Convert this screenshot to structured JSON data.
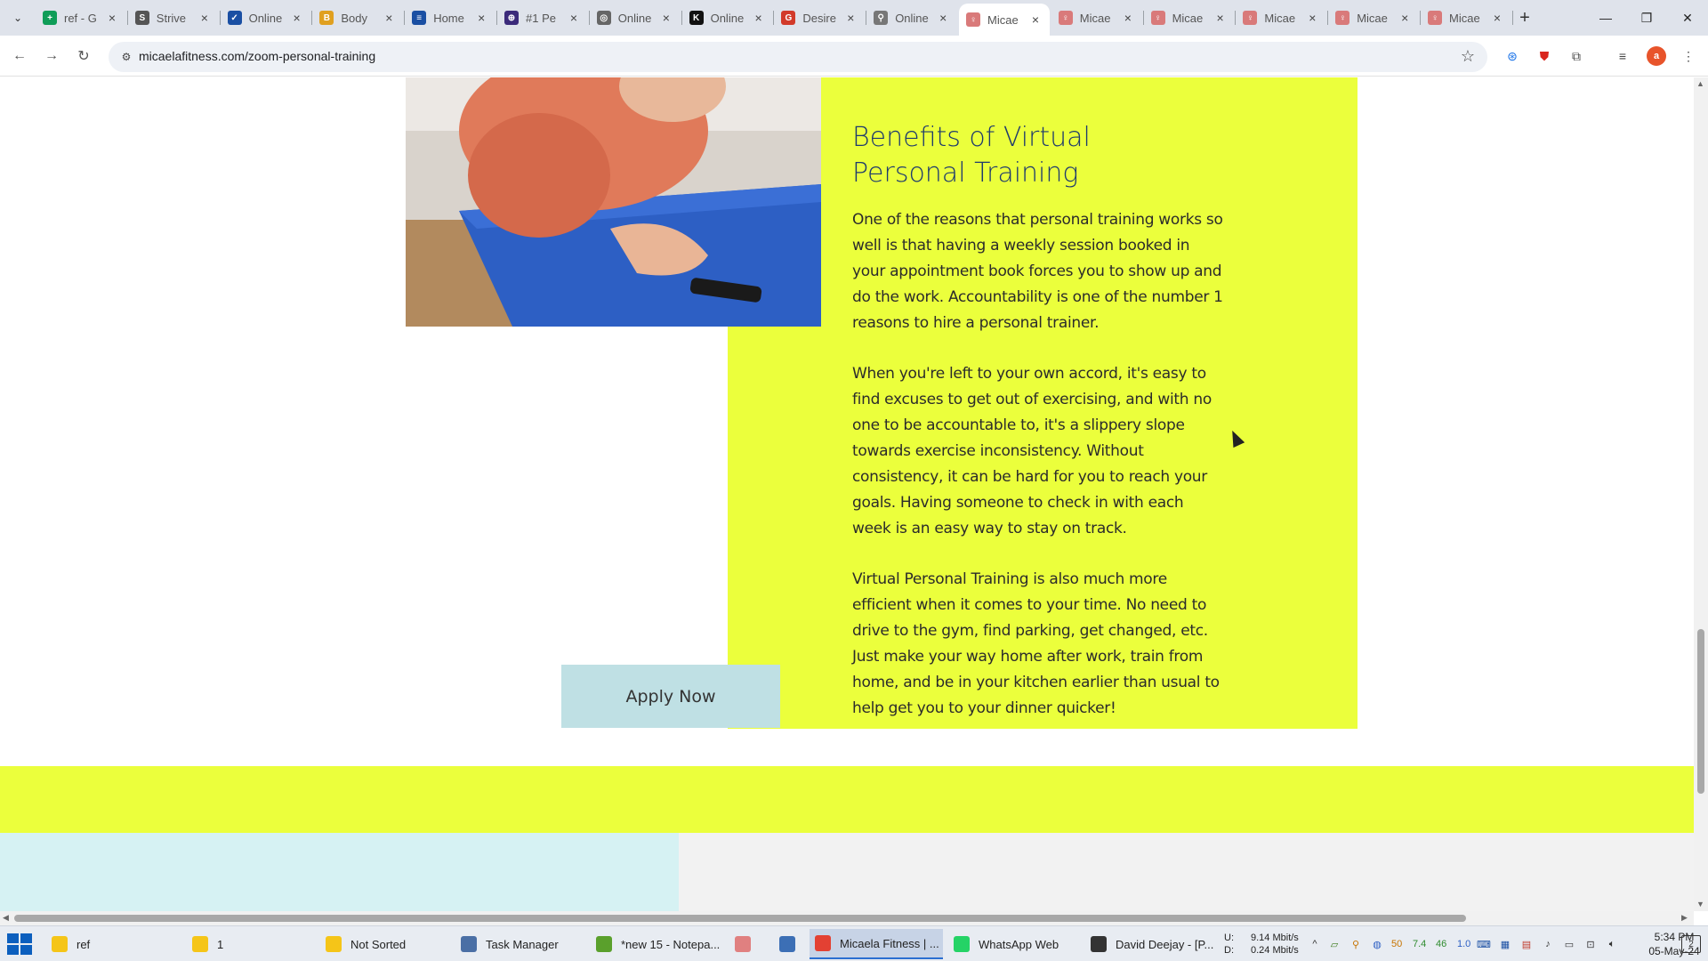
{
  "browser": {
    "tabs": [
      {
        "title": "ref - G",
        "color": "#0f9d58",
        "glyph": "+"
      },
      {
        "title": "Strive",
        "color": "#555555",
        "glyph": "S"
      },
      {
        "title": "Online",
        "color": "#1a4fa3",
        "glyph": "✓"
      },
      {
        "title": "Body",
        "color": "#e0a020",
        "glyph": "B"
      },
      {
        "title": "Home",
        "color": "#1a4fa3",
        "glyph": "≡"
      },
      {
        "title": "#1 Pe",
        "color": "#3b2a7a",
        "glyph": "⊕"
      },
      {
        "title": "Online",
        "color": "#666666",
        "glyph": "◎"
      },
      {
        "title": "Online",
        "color": "#111111",
        "glyph": "K"
      },
      {
        "title": "Desire",
        "color": "#d23a2a",
        "glyph": "G"
      },
      {
        "title": "Online",
        "color": "#777777",
        "glyph": "⚲"
      },
      {
        "title": "Micae",
        "color": "#d97a7a",
        "glyph": "♀",
        "active": true
      },
      {
        "title": "Micae",
        "color": "#d97a7a",
        "glyph": "♀"
      },
      {
        "title": "Micae",
        "color": "#d97a7a",
        "glyph": "♀"
      },
      {
        "title": "Micae",
        "color": "#d97a7a",
        "glyph": "♀"
      },
      {
        "title": "Micae",
        "color": "#d97a7a",
        "glyph": "♀"
      },
      {
        "title": "Micae",
        "color": "#d97a7a",
        "glyph": "♀"
      }
    ],
    "url": "micaelafitness.com/zoom-personal-training",
    "profile_initial": "a"
  },
  "page": {
    "heading": "Benefits of Virtual Personal Training",
    "paragraphs": [
      "One of the reasons that personal training works so well is that having a weekly session booked in your appointment book forces you to show up and do the work. Accountability is one of the number 1 reasons to hire a personal trainer.",
      "When you're left to your own accord, it's easy to find excuses to get out of exercising, and with no one to be accountable to, it's a slippery slope towards exercise inconsistency.  Without consistency, it can be hard for you to reach your goals. Having someone to check in with each week is an easy way to stay on track.",
      "Virtual Personal Training is also much more efficient when it comes to your time. No need to drive to the gym, find parking, get changed, etc. Just make your way home after work, train from home, and be in your kitchen earlier than usual to help get you to your dinner quicker!"
    ],
    "apply_button": "Apply Now",
    "accent_color": "#ebff3c",
    "button_color": "#bfe0e4"
  },
  "taskbar": {
    "items": [
      {
        "label": "ref",
        "color": "#f5c518"
      },
      {
        "label": "1",
        "color": "#f5c518"
      },
      {
        "label": "Not Sorted",
        "color": "#f5c518"
      },
      {
        "label": "Task Manager",
        "color": "#4a6fa5"
      },
      {
        "label": "*new 15 - Notepa...",
        "color": "#5aa02c"
      },
      {
        "label": "",
        "color": "#e08080"
      },
      {
        "label": "",
        "color": "#3c6fb5"
      },
      {
        "label": "Micaela Fitness | ...",
        "color": "#e34133",
        "active": true
      },
      {
        "label": "WhatsApp Web",
        "color": "#25d366"
      },
      {
        "label": "David Deejay - [P...",
        "color": "#333333"
      }
    ],
    "net_up": "U:",
    "net_down": "D:",
    "net_up_value": "9.14 Mbit/s",
    "net_down_value": "0.24 Mbit/s",
    "tray_numbers": [
      "50",
      "7.4",
      "46",
      "1.0"
    ],
    "time": "5:34 PM",
    "date": "05-May-24",
    "notification_count": "2"
  }
}
